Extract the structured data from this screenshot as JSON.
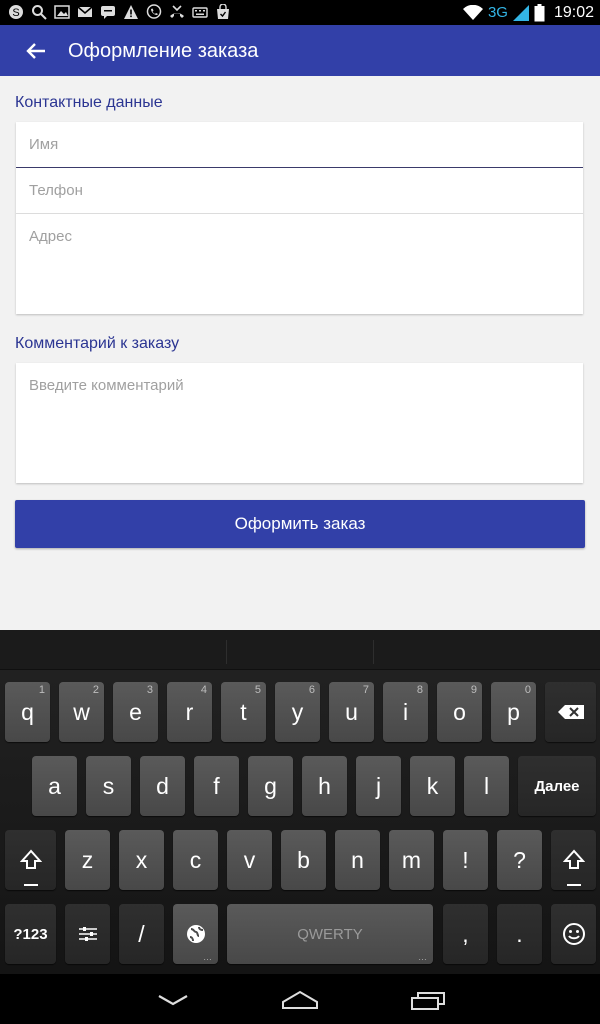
{
  "status_bar": {
    "time": "19:02",
    "network": "3G",
    "notification_icons": [
      "skype-icon",
      "search-icon",
      "image-icon",
      "gmail-icon",
      "chat-icon",
      "warning-icon",
      "viber-icon",
      "missed-call-icon",
      "keyboard-icon",
      "store-icon"
    ],
    "system_icons": [
      "wifi-icon",
      "signal-icon",
      "battery-icon"
    ]
  },
  "app_bar": {
    "title": "Оформление заказа",
    "back_icon": "arrow-back-icon",
    "color": "#3240a8"
  },
  "contact_section": {
    "title": "Контактные данные",
    "name_placeholder": "Имя",
    "phone_placeholder": "Телфон",
    "address_placeholder": "Адрес"
  },
  "comment_section": {
    "title": "Комментарий к заказу",
    "comment_placeholder": "Введите комментарий"
  },
  "submit_label": "Оформить заказ",
  "keyboard": {
    "row1": [
      {
        "label": "q",
        "hint": "1"
      },
      {
        "label": "w",
        "hint": "2"
      },
      {
        "label": "e",
        "hint": "3"
      },
      {
        "label": "r",
        "hint": "4"
      },
      {
        "label": "t",
        "hint": "5"
      },
      {
        "label": "y",
        "hint": "6"
      },
      {
        "label": "u",
        "hint": "7"
      },
      {
        "label": "i",
        "hint": "8"
      },
      {
        "label": "o",
        "hint": "9"
      },
      {
        "label": "p",
        "hint": "0"
      }
    ],
    "row2": [
      "a",
      "s",
      "d",
      "f",
      "g",
      "h",
      "j",
      "k",
      "l"
    ],
    "enter_label": "Далее",
    "row3": [
      "z",
      "x",
      "c",
      "v",
      "b",
      "n",
      "m",
      "!",
      "?"
    ],
    "symbols_label": "?123",
    "slash_label": "/",
    "space_label": "QWERTY",
    "comma_label": ",",
    "period_label": "."
  },
  "nav_bar": {
    "icons": [
      "back-nav-icon",
      "home-nav-icon",
      "recents-nav-icon"
    ]
  }
}
